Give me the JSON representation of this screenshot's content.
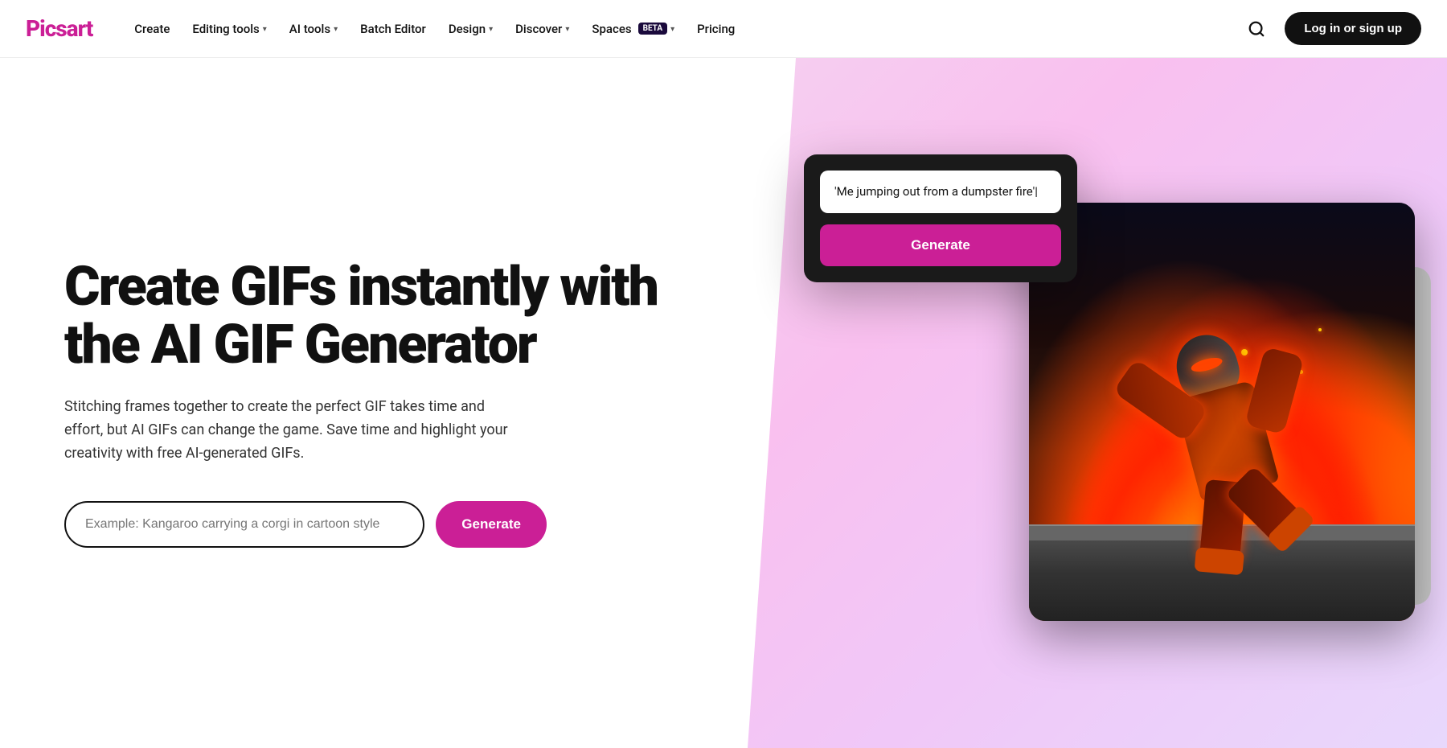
{
  "brand": {
    "name": "Picsart",
    "logo_color": "#cb1f96"
  },
  "nav": {
    "items": [
      {
        "label": "Create",
        "has_dropdown": false
      },
      {
        "label": "Editing tools",
        "has_dropdown": true
      },
      {
        "label": "AI tools",
        "has_dropdown": true
      },
      {
        "label": "Batch Editor",
        "has_dropdown": false
      },
      {
        "label": "Design",
        "has_dropdown": true
      },
      {
        "label": "Discover",
        "has_dropdown": true
      },
      {
        "label": "Spaces",
        "has_dropdown": true,
        "badge": "BETA"
      },
      {
        "label": "Pricing",
        "has_dropdown": false
      }
    ],
    "login_label": "Log in or sign up"
  },
  "hero": {
    "title": "Create GIFs instantly with the AI GIF Generator",
    "subtitle": "Stitching frames together to create the perfect GIF takes time and effort, but AI GIFs can change the game. Save time and highlight your creativity with free AI-generated GIFs.",
    "input_placeholder": "Example: Kangaroo carrying a corgi in cartoon style",
    "generate_label": "Generate"
  },
  "ai_card": {
    "prompt_text": "'Me jumping out from a dumpster fire'|",
    "button_label": "Generate"
  }
}
